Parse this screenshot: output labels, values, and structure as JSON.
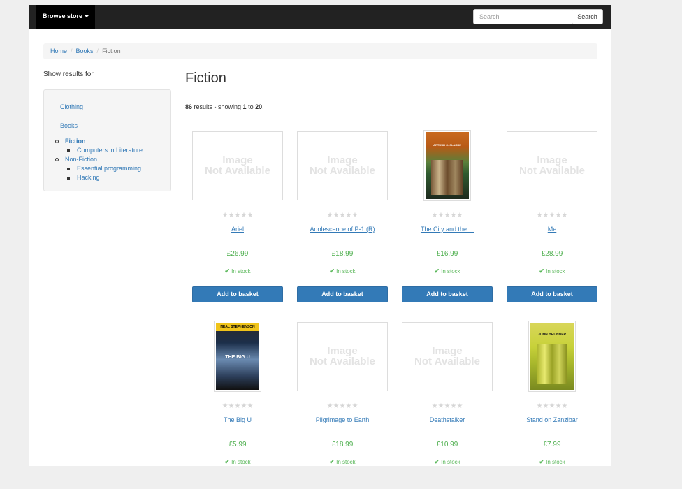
{
  "navbar": {
    "browse_label": "Browse store",
    "search_placeholder": "Search",
    "search_button": "Search"
  },
  "breadcrumb": {
    "home": "Home",
    "books": "Books",
    "current": "Fiction"
  },
  "sidebar": {
    "heading": "Show results for",
    "clothing": "Clothing",
    "books": "Books",
    "fiction": "Fiction",
    "computers_in_literature": "Computers in Literature",
    "non_fiction": "Non-Fiction",
    "essential_programming": "Essential programming",
    "hacking": "Hacking"
  },
  "main": {
    "title": "Fiction",
    "results_count": "86",
    "results_text": " results - showing ",
    "range_start": "1",
    "range_to": " to ",
    "range_end": "20",
    "range_period": "."
  },
  "image_na": {
    "line1": "Image",
    "line2": "Not Available"
  },
  "stars": "★★★★★",
  "colors": {
    "link": "#337ab7",
    "button": "#337ab7",
    "price": "#4cae4c",
    "navbar": "#222222"
  },
  "products": [
    {
      "title": "Ariel",
      "price": "£26.99",
      "stock": "In stock",
      "button": "Add to basket"
    },
    {
      "title": "Adolescence of P-1 (R)",
      "price": "£18.99",
      "stock": "In stock",
      "button": "Add to basket"
    },
    {
      "title": "The City and the ...",
      "price": "£16.99",
      "stock": "In stock",
      "button": "Add to basket",
      "cover_text": "ARTHUR C. CLARKE"
    },
    {
      "title": "Me",
      "price": "£28.99",
      "stock": "In stock",
      "button": "Add to basket"
    },
    {
      "title": "The Big U",
      "price": "£5.99",
      "stock": "In stock",
      "cover_author": "NEAL STEPHENSON",
      "cover_text": "THE BIG U"
    },
    {
      "title": "Pilgrimage to Earth",
      "price": "£18.99",
      "stock": "In stock"
    },
    {
      "title": "Deathstalker",
      "price": "£10.99",
      "stock": "In stock"
    },
    {
      "title": "Stand on Zanzibar",
      "price": "£7.99",
      "stock": "In stock",
      "cover_text": "JOHN BRUNNER"
    }
  ]
}
